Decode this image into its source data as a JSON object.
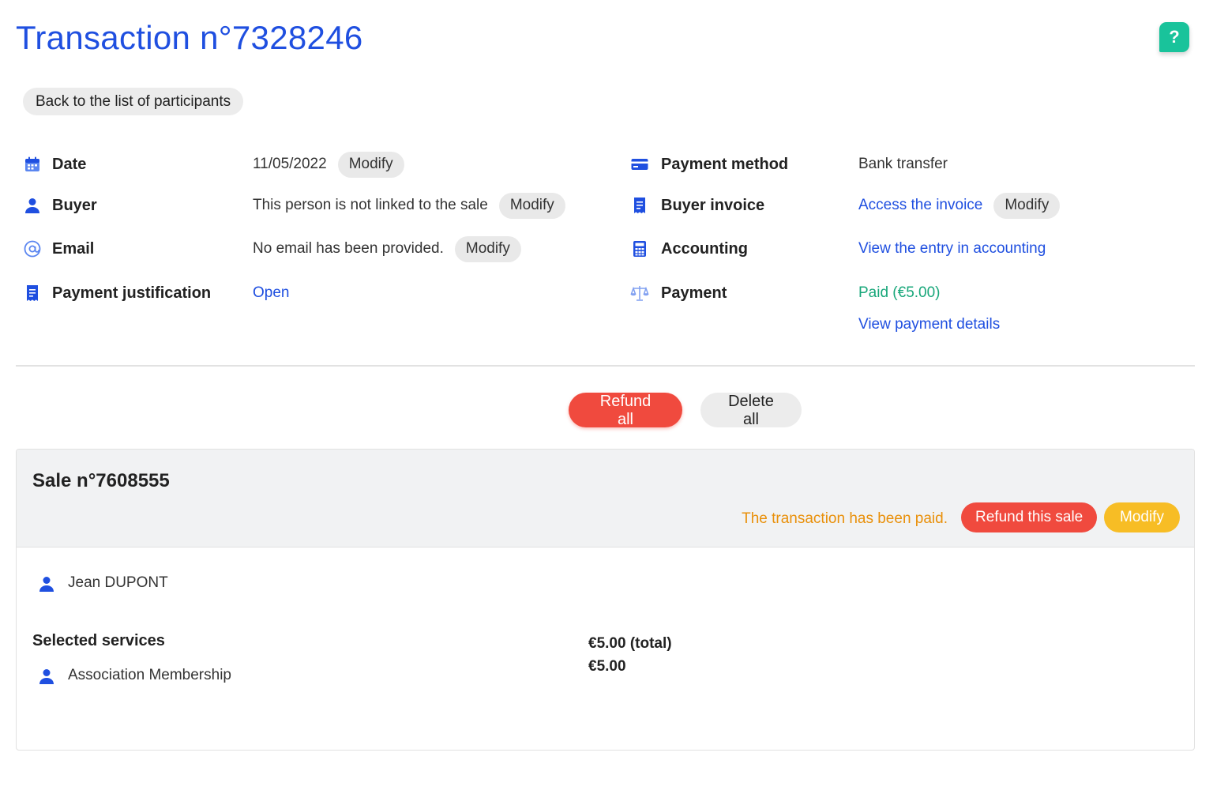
{
  "page": {
    "title": "Transaction n°7328246",
    "help_label": "?",
    "back_label": "Back to the list of participants"
  },
  "details_left": [
    {
      "icon": "calendar-icon",
      "label": "Date",
      "value": "11/05/2022",
      "action": "Modify"
    },
    {
      "icon": "user-icon",
      "label": "Buyer",
      "value": "This person is not linked to the sale",
      "action": "Modify"
    },
    {
      "icon": "at-sign-icon",
      "label": "Email",
      "value": "No email has been provided.",
      "action": "Modify"
    },
    {
      "icon": "receipt-icon",
      "label": "Payment justification",
      "link": "Open"
    }
  ],
  "details_right": [
    {
      "icon": "credit-card-icon",
      "label": "Payment method",
      "value": "Bank transfer"
    },
    {
      "icon": "receipt-icon",
      "label": "Buyer invoice",
      "link": "Access the invoice",
      "action": "Modify"
    },
    {
      "icon": "calculator-icon",
      "label": "Accounting",
      "link": "View the entry in accounting"
    },
    {
      "icon": "scale-icon",
      "label": "Payment",
      "status": "Paid (€5.00)",
      "link": "View payment details"
    }
  ],
  "actions": {
    "refund_all": "Refund all",
    "delete_all": "Delete all"
  },
  "sale": {
    "title": "Sale n°7608555",
    "status": "The transaction has been paid.",
    "refund_label": "Refund this sale",
    "modify_label": "Modify",
    "participant": "Jean DUPONT",
    "services_heading": "Selected services",
    "service_name": "Association Membership",
    "total": "€5.00 (total)",
    "service_price": "€5.00"
  },
  "colors": {
    "brand_blue": "#1f4fe0",
    "help_green": "#19c39b",
    "paid_green": "#18a77a",
    "danger_red": "#f04a3e",
    "warning_yellow": "#f7bd25",
    "status_orange": "#e9900a"
  }
}
